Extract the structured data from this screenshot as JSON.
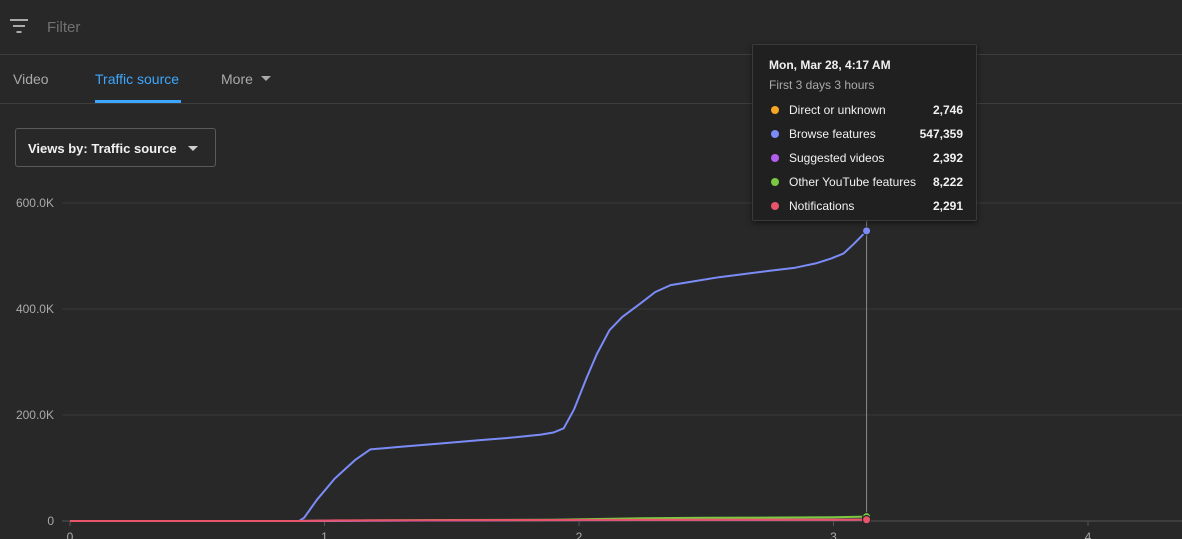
{
  "filter": {
    "placeholder": "Filter",
    "icon": "filter-icon"
  },
  "tabs": [
    {
      "label": "Video",
      "active": false
    },
    {
      "label": "Traffic source",
      "active": true
    },
    {
      "label": "More",
      "active": false
    }
  ],
  "views_dropdown": {
    "label": "Views by: Traffic source"
  },
  "colors": {
    "direct": "#f5a623",
    "browse": "#7b8cf8",
    "suggested": "#b45ef0",
    "other": "#7ac943",
    "notifications": "#e8546a",
    "grid": "#3a3a3a",
    "axis_text": "#aaaaaa"
  },
  "tooltip": {
    "title": "Mon, Mar 28, 4:17 AM",
    "subtitle": "First 3 days 3 hours",
    "rows": [
      {
        "name": "Direct or unknown",
        "value": "2,746",
        "color": "#f5a623"
      },
      {
        "name": "Browse features",
        "value": "547,359",
        "color": "#7b8cf8"
      },
      {
        "name": "Suggested videos",
        "value": "2,392",
        "color": "#b45ef0"
      },
      {
        "name": "Other YouTube features",
        "value": "8,222",
        "color": "#7ac943"
      },
      {
        "name": "Notifications",
        "value": "2,291",
        "color": "#e8546a"
      }
    ]
  },
  "chart_data": {
    "type": "line",
    "xlim": [
      0,
      4.4
    ],
    "ylim": [
      0,
      600000
    ],
    "xticks": [
      0,
      1,
      2,
      3,
      4
    ],
    "xtick_labels": [
      "0",
      "1",
      "2",
      "3",
      "4"
    ],
    "yticks": [
      0,
      200000,
      400000,
      600000
    ],
    "ytick_labels": [
      "0",
      "200.0K",
      "400.0K",
      "600.0K"
    ],
    "grid": true,
    "hover_x": 3.13,
    "series": [
      {
        "name": "Browse features",
        "color": "#7b8cf8",
        "points": [
          [
            0,
            0
          ],
          [
            0.9,
            0
          ],
          [
            0.92,
            6000
          ],
          [
            0.97,
            40000
          ],
          [
            1.04,
            80000
          ],
          [
            1.12,
            115000
          ],
          [
            1.18,
            135000
          ],
          [
            1.3,
            140000
          ],
          [
            1.45,
            146000
          ],
          [
            1.6,
            152000
          ],
          [
            1.75,
            158000
          ],
          [
            1.85,
            163000
          ],
          [
            1.9,
            167000
          ],
          [
            1.94,
            175000
          ],
          [
            1.98,
            210000
          ],
          [
            2.03,
            270000
          ],
          [
            2.07,
            315000
          ],
          [
            2.12,
            360000
          ],
          [
            2.17,
            385000
          ],
          [
            2.24,
            410000
          ],
          [
            2.3,
            432000
          ],
          [
            2.36,
            445000
          ],
          [
            2.45,
            452000
          ],
          [
            2.55,
            460000
          ],
          [
            2.65,
            466000
          ],
          [
            2.75,
            472000
          ],
          [
            2.85,
            478000
          ],
          [
            2.93,
            486000
          ],
          [
            2.99,
            495000
          ],
          [
            3.04,
            505000
          ],
          [
            3.08,
            523000
          ],
          [
            3.13,
            547359
          ]
        ]
      },
      {
        "name": "Other YouTube features",
        "color": "#7ac943",
        "points": [
          [
            0,
            0
          ],
          [
            0.9,
            0
          ],
          [
            1.0,
            600
          ],
          [
            1.2,
            1200
          ],
          [
            1.5,
            1800
          ],
          [
            1.9,
            2400
          ],
          [
            2.1,
            4000
          ],
          [
            2.25,
            5200
          ],
          [
            2.5,
            6000
          ],
          [
            2.8,
            6600
          ],
          [
            3.0,
            7200
          ],
          [
            3.13,
            8222
          ]
        ]
      },
      {
        "name": "Direct or unknown",
        "color": "#f5a623",
        "points": [
          [
            0,
            0
          ],
          [
            0.9,
            0
          ],
          [
            1.2,
            800
          ],
          [
            1.6,
            1400
          ],
          [
            2.0,
            1900
          ],
          [
            2.4,
            2300
          ],
          [
            2.8,
            2600
          ],
          [
            3.13,
            2746
          ]
        ]
      },
      {
        "name": "Suggested videos",
        "color": "#b45ef0",
        "points": [
          [
            0,
            0
          ],
          [
            0.9,
            0
          ],
          [
            1.2,
            700
          ],
          [
            1.6,
            1200
          ],
          [
            2.0,
            1700
          ],
          [
            2.4,
            2000
          ],
          [
            2.8,
            2250
          ],
          [
            3.13,
            2392
          ]
        ]
      },
      {
        "name": "Notifications",
        "color": "#e8546a",
        "points": [
          [
            0,
            0
          ],
          [
            0.9,
            0
          ],
          [
            1.05,
            1100
          ],
          [
            1.4,
            1500
          ],
          [
            1.8,
            1800
          ],
          [
            2.2,
            2000
          ],
          [
            2.7,
            2200
          ],
          [
            3.13,
            2291
          ]
        ]
      }
    ]
  }
}
